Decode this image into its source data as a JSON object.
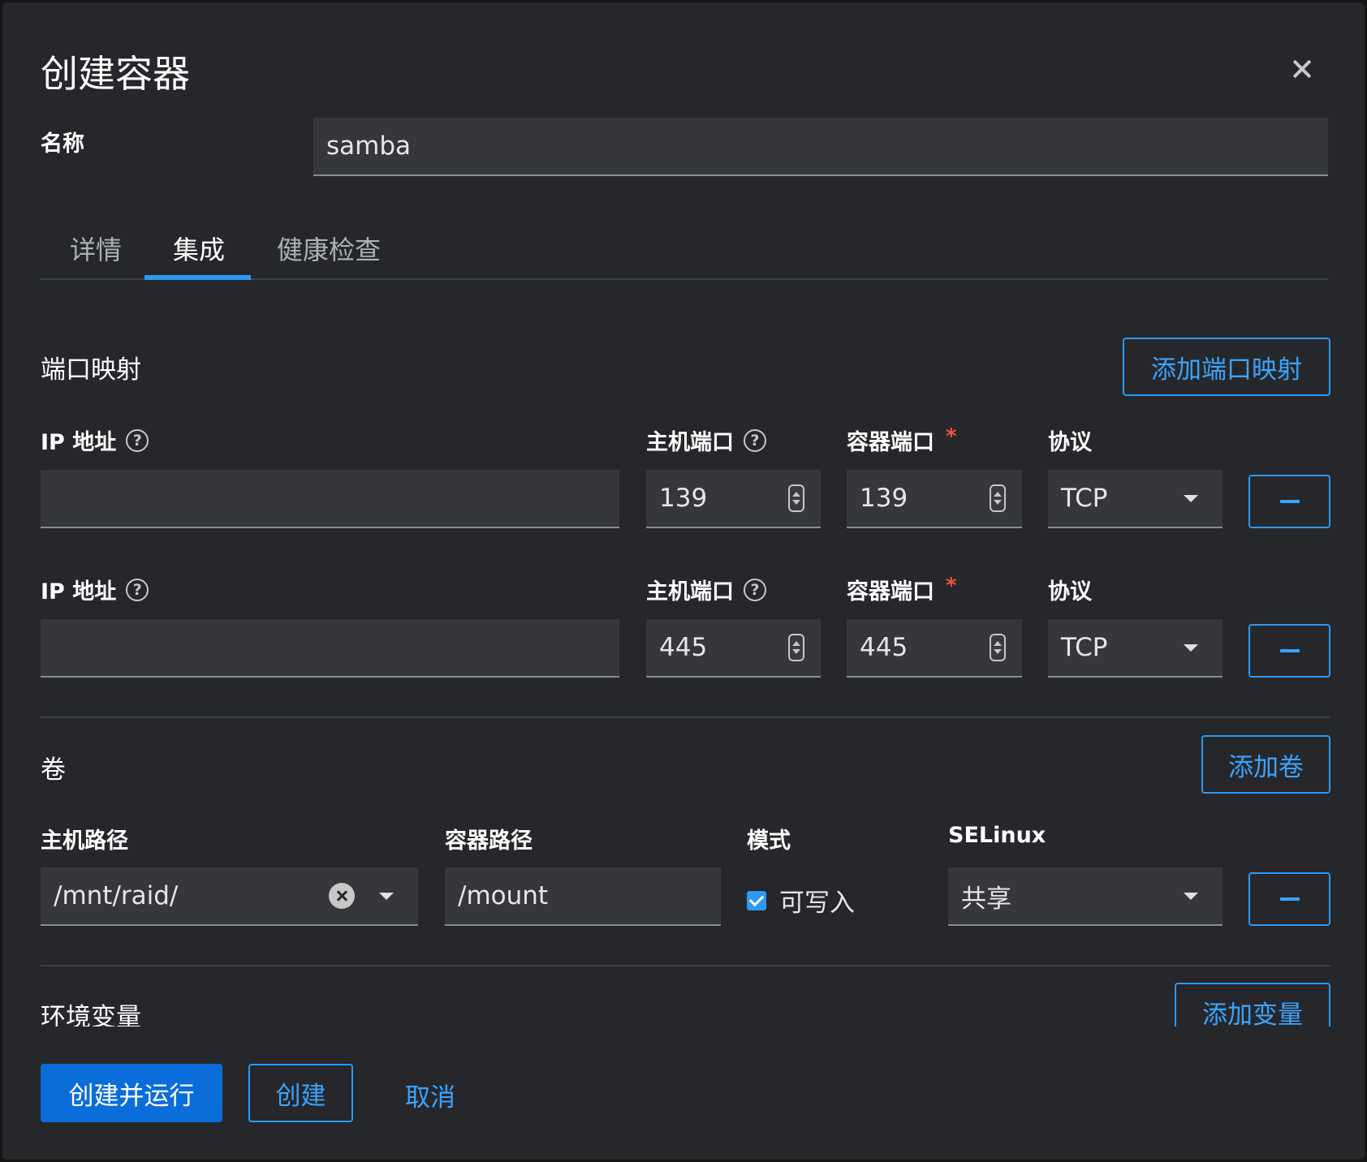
{
  "modal": {
    "title": "创建容器"
  },
  "name_field": {
    "label": "名称",
    "value": "samba"
  },
  "tabs": [
    {
      "label": "详情",
      "active": false
    },
    {
      "label": "集成",
      "active": true
    },
    {
      "label": "健康检查",
      "active": false
    }
  ],
  "ports": {
    "section_title": "端口映射",
    "add_button": "添加端口映射",
    "labels": {
      "ip": "IP 地址",
      "host_port": "主机端口",
      "container_port": "容器端口",
      "required_mark": "*",
      "protocol": "协议"
    },
    "rows": [
      {
        "ip": "",
        "host_port": "139",
        "container_port": "139",
        "protocol": "TCP"
      },
      {
        "ip": "",
        "host_port": "445",
        "container_port": "445",
        "protocol": "TCP"
      }
    ]
  },
  "volumes": {
    "section_title": "卷",
    "add_button": "添加卷",
    "labels": {
      "host_path": "主机路径",
      "container_path": "容器路径",
      "mode": "模式",
      "selinux": "SELinux"
    },
    "rows": [
      {
        "host_path": "/mnt/raid/",
        "container_path": "/mount",
        "writable_label": "可写入",
        "writable": true,
        "selinux": "共享"
      }
    ]
  },
  "env": {
    "section_title": "环境变量",
    "add_button": "添加变量"
  },
  "footer": {
    "create_run": "创建并运行",
    "create": "创建",
    "cancel": "取消"
  },
  "colors": {
    "accent": "#2b9af3",
    "primary_button": "#0a6dd9",
    "required": "#f0523f",
    "background": "#26272b"
  }
}
